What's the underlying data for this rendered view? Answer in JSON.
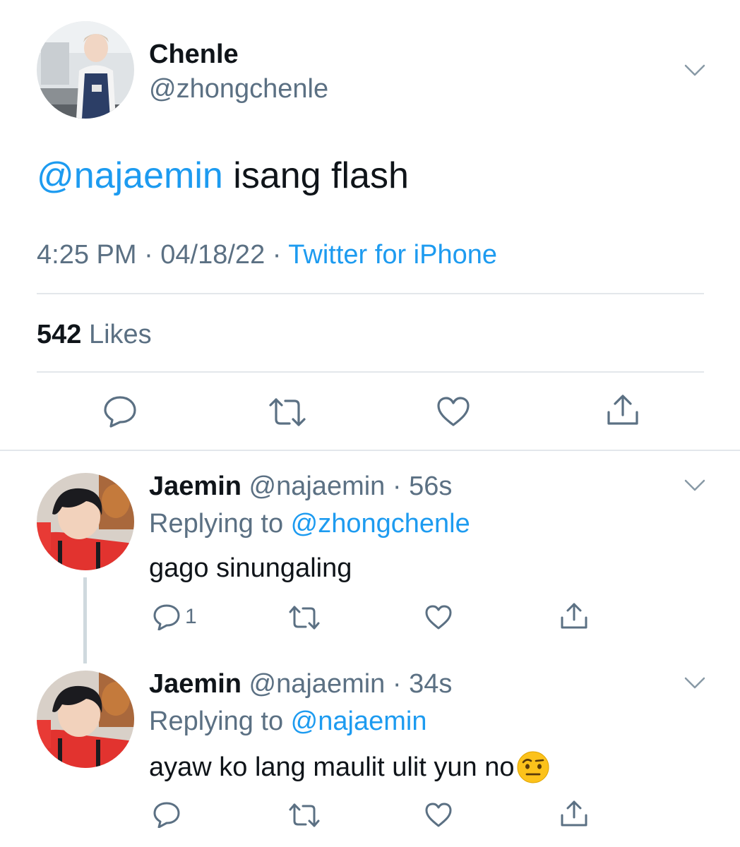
{
  "main_tweet": {
    "author_name": "Chenle",
    "author_handle": "@zhongchenle",
    "mention": "@najaemin",
    "text": " isang flash",
    "time": "4:25 PM · 04/18/22 · ",
    "source": "Twitter for iPhone",
    "likes_count": "542",
    "likes_label": " Likes"
  },
  "replies": [
    {
      "author_name": "Jaemin",
      "author_handle": " @najaemin · 56s",
      "replying_label": "Replying to ",
      "replying_to": "@zhongchenle",
      "text": "gago sinungaling",
      "reply_count": "1"
    },
    {
      "author_name": "Jaemin",
      "author_handle": " @najaemin · 34s",
      "replying_label": "Replying to ",
      "replying_to": "@najaemin",
      "text": "ayaw ko lang maulit ulit yun no",
      "emoji": "face-with-raised-eyebrow"
    }
  ],
  "icons": {
    "reply": "reply-icon",
    "retweet": "retweet-icon",
    "like": "heart-icon",
    "share": "share-icon",
    "more": "chevron-down-icon"
  },
  "colors": {
    "accent": "#1d9bf0",
    "secondary_text": "#5b7083",
    "divider": "#e3e7eb"
  }
}
